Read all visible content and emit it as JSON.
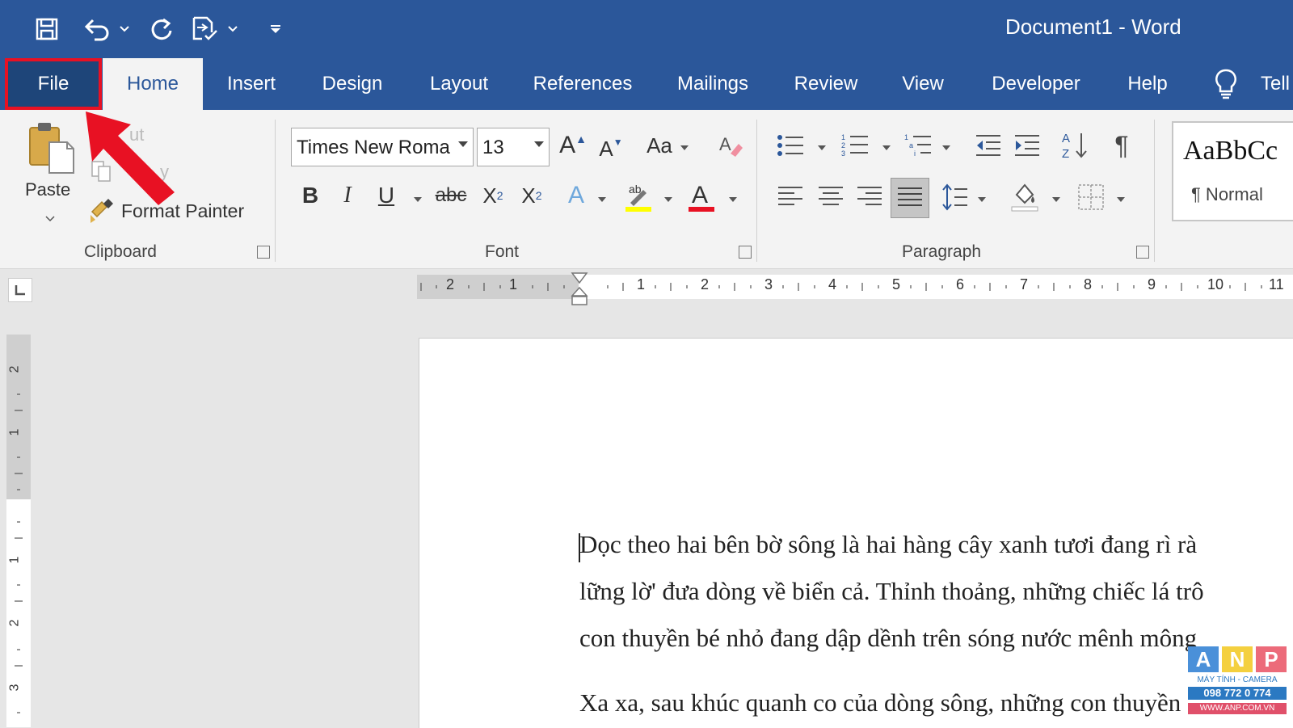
{
  "title_bar": {
    "document_title": "Document1  -  Word"
  },
  "tabs": [
    {
      "label": "File"
    },
    {
      "label": "Home"
    },
    {
      "label": "Insert"
    },
    {
      "label": "Design"
    },
    {
      "label": "Layout"
    },
    {
      "label": "References"
    },
    {
      "label": "Mailings"
    },
    {
      "label": "Review"
    },
    {
      "label": "View"
    },
    {
      "label": "Developer"
    },
    {
      "label": "Help"
    },
    {
      "label": "Tell"
    }
  ],
  "clipboard": {
    "paste_label": "Paste",
    "cut_label": "ut",
    "copy_label": "y",
    "format_painter_label": "Format Painter",
    "group_label": "Clipboard"
  },
  "font": {
    "font_name": "Times New Roma",
    "font_size": "13",
    "change_case_label": "Aa",
    "group_label": "Font"
  },
  "paragraph": {
    "group_label": "Paragraph"
  },
  "styles": {
    "preview_text": "AaBbCc",
    "normal_label": "¶ Normal"
  },
  "ruler": {
    "left_numbers": [
      "2",
      "1"
    ],
    "right_numbers": [
      "1",
      "2",
      "3",
      "4",
      "5",
      "6",
      "7",
      "8",
      "9",
      "10",
      "11"
    ],
    "vertical_numbers": [
      "2",
      "1",
      "1",
      "2",
      "3"
    ]
  },
  "document": {
    "lines": [
      "Dọc theo hai bên bờ sông là hai hàng cây xanh tươi đang rì rà",
      "lững lờ' đưa dòng về biển cả. Thỉnh thoảng, những chiếc lá trô",
      "con thuyền bé nhỏ đang dập dềnh trên sóng nước mênh mông",
      "Xa xa, sau khúc quanh co của dòng sông, những con thuyền"
    ]
  },
  "watermark": {
    "letters": [
      "A",
      "N",
      "P"
    ],
    "line1": "MÁY TÍNH - CAMERA",
    "line2": "098 772 0 774",
    "line3": "WWW.ANP.COM.VN"
  },
  "colors": {
    "title_bar": "#2b579a",
    "ribbon": "#f3f3f3",
    "highlight_callout": "#e81123",
    "highlight_yellow": "#ffff00",
    "font_color_red": "#e81123"
  }
}
